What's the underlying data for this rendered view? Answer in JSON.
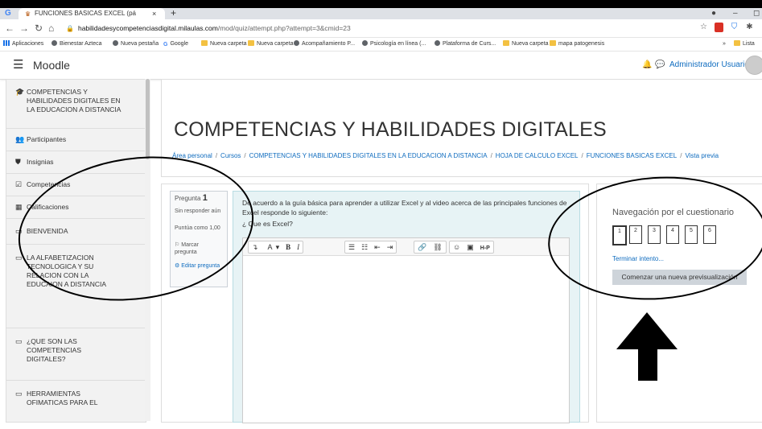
{
  "browser": {
    "tab_title": "FUNCIONES BASICAS EXCEL (pá",
    "tab_close": "×",
    "new_tab": "+",
    "url_host": "habilidadesycompetenciasdigital.milaulas.com",
    "url_path": "/mod/quiz/attempt.php?attempt=3&cmid=23",
    "bookmarks": [
      {
        "label": "Aplicaciones",
        "icon": "apps-icon"
      },
      {
        "label": "Bienestar Azteca",
        "icon": "globe-icon"
      },
      {
        "label": "Nueva pestaña",
        "icon": "globe-icon"
      },
      {
        "label": "Google",
        "icon": "google-icon"
      },
      {
        "label": "Nueva carpeta",
        "icon": "folder-icon"
      },
      {
        "label": "Nueva carpeta",
        "icon": "folder-icon"
      },
      {
        "label": "Acompañamiento P...",
        "icon": "globe-icon"
      },
      {
        "label": "Psicología en línea (...",
        "icon": "globe-icon"
      },
      {
        "label": "Plataforma de Curs...",
        "icon": "globe-icon"
      },
      {
        "label": "Nueva carpeta",
        "icon": "folder-icon"
      },
      {
        "label": "mapa patogenesis",
        "icon": "folder-icon"
      }
    ],
    "bookmarks_more": "»",
    "reading_list": "Lista"
  },
  "navbar": {
    "brand": "Moodle",
    "user_name": "Administrador Usuario"
  },
  "drawer": {
    "items": [
      {
        "label": "COMPETENCIAS Y HABILIDADES DIGITALES EN LA EDUCACION A DISTANCIA",
        "icon": "graduation-cap-icon"
      },
      {
        "label": "Participantes",
        "icon": "users-icon"
      },
      {
        "label": "Insignias",
        "icon": "badge-icon"
      },
      {
        "label": "Competencias",
        "icon": "check-square-icon"
      },
      {
        "label": "Calificaciones",
        "icon": "table-icon"
      },
      {
        "label": "BIENVENIDA",
        "icon": "folder-icon"
      },
      {
        "label": "LA ALFABETIZACION TECNOLOGICA Y SU RELACION CON LA EDUCAION A DISTANCIA",
        "icon": "folder-icon"
      },
      {
        "label": "¿QUE SON LAS COMPETENCIAS DIGITALES?",
        "icon": "folder-icon"
      },
      {
        "label": "HERRAMIENTAS OFIMATICAS PARA EL",
        "icon": "folder-icon"
      }
    ]
  },
  "page": {
    "heading": "COMPETENCIAS Y HABILIDADES DIGITALES",
    "breadcrumbs": [
      "Área personal",
      "Cursos",
      "COMPETENCIAS Y HABILIDADES DIGITALES EN LA EDUCACION A DISTANCIA",
      "HOJA DE CALCULO EXCEL",
      "FUNCIONES BASICAS EXCEL",
      "Vista previa"
    ],
    "breadcrumb_sep": "/"
  },
  "question": {
    "label": "Pregunta",
    "number": "1",
    "status": "Sin responder aún",
    "points": "Puntúa como 1,00",
    "flag": "Marcar pregunta",
    "edit": "Editar pregunta",
    "text": "De acuerdo a la  guía básica  para  aprender a utilizar  Excel y al video acerca de las  principales funciones de Excel responde  lo siguiente:",
    "prompt": "¿ Que es Excel?"
  },
  "editor_toolbar": {
    "font": "A",
    "bold": "B",
    "italic": "I",
    "h5p": "H-P"
  },
  "quiz_nav": {
    "title": "Navegación por el cuestionario",
    "questions": [
      "1",
      "2",
      "3",
      "4",
      "5",
      "6"
    ],
    "finish": "Terminar intento...",
    "new_preview": "Comenzar una nueva previsualización"
  }
}
